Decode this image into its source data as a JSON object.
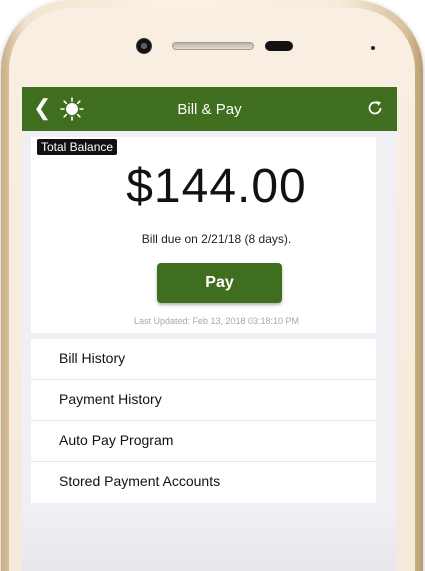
{
  "navbar": {
    "title": "Bill & Pay",
    "back_icon": "chevron-left-icon",
    "logo_icon": "sun-logo-icon",
    "refresh_icon": "refresh-icon",
    "bar_color": "#3f6e1e"
  },
  "balance": {
    "tag_label": "Total Balance",
    "amount": "$144.00",
    "due_text": "Bill due on 2/21/18 (8 days).",
    "pay_label": "Pay",
    "last_updated": "Last Updated: Feb 13, 2018 03:18:10 PM"
  },
  "menu": {
    "items": [
      {
        "label": "Bill History"
      },
      {
        "label": "Payment History"
      },
      {
        "label": "Auto Pay Program"
      },
      {
        "label": "Stored Payment Accounts"
      }
    ]
  }
}
